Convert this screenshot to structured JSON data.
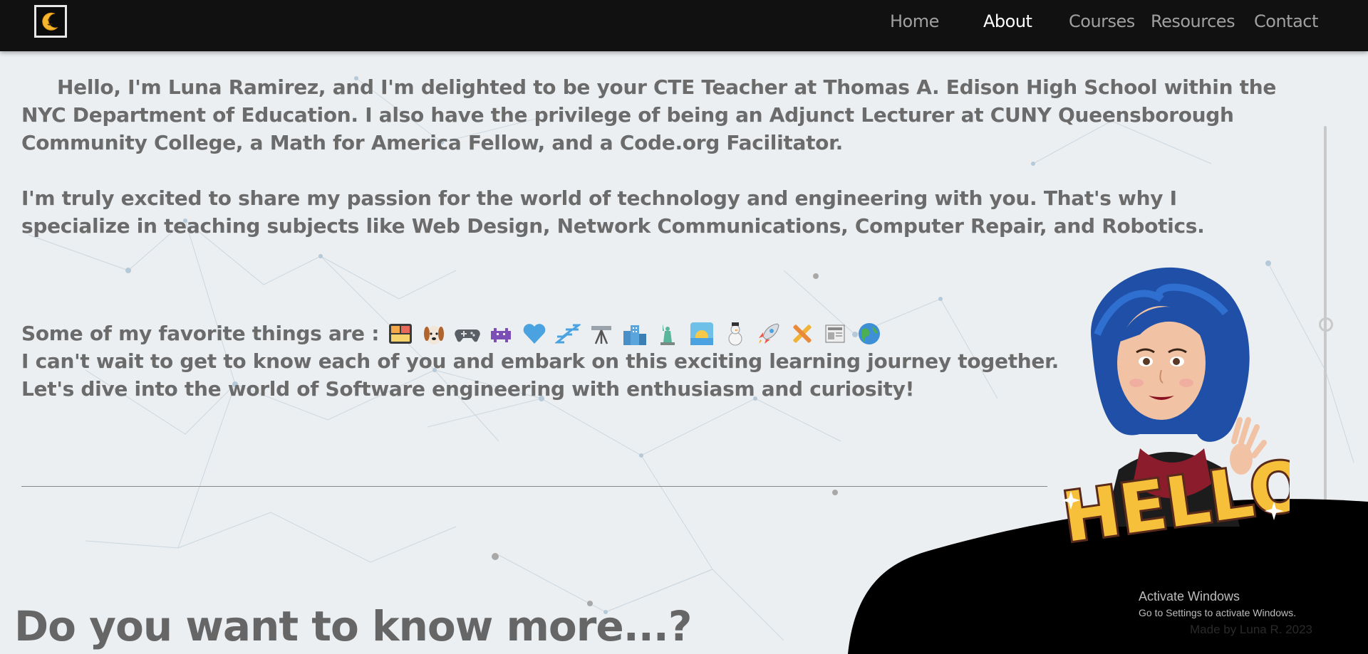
{
  "nav": {
    "logo": "logo-icon",
    "links": [
      "Home",
      "About",
      "Courses",
      "Resources",
      "Contact"
    ],
    "active": "About"
  },
  "intro": {
    "p1": "Hello, I'm Luna Ramirez, and I'm delighted to be your CTE Teacher at Thomas A. Edison High School within the NYC Department of Education. I also have the privilege of being an Adjunct Lecturer at CUNY Queensborough Community College, a Math for America Fellow, and a Code.org Facilitator.",
    "p2": "I'm truly excited to share my passion for the world of technology and engineering with you. That's why I specialize in teaching subjects like Web Design, Network Communications, Computer Repair, and Robotics.",
    "favorites_label": "Some of my favorite things are :",
    "favorites": [
      "bento-box-icon",
      "dog-icon",
      "game-controller-icon",
      "space-invader-icon",
      "blue-heart-icon",
      "sleeping-zzz-icon",
      "telescope-icon",
      "city-buildings-icon",
      "statue-of-liberty-icon",
      "sunrise-icon",
      "snowman-icon",
      "rocket-icon",
      "tools-icon",
      "newspaper-icon",
      "globe-icon"
    ],
    "p4": "I can't wait to get to know each of you and embark on this exciting learning journey together. Let's dive into the world of Software engineering with enthusiasm and curiosity!"
  },
  "section_heading": "Do you want to know more...?",
  "avatar_label": "HELLO",
  "windows_notice": {
    "title": "Activate Windows",
    "subtitle": "Go to Settings to activate Windows."
  },
  "footer": {
    "credit": "Made by Luna R. 2023"
  },
  "colors": {
    "navbar": "#111111",
    "background": "#eceff1",
    "text": "#6b6b6b",
    "blob": "#000000"
  }
}
